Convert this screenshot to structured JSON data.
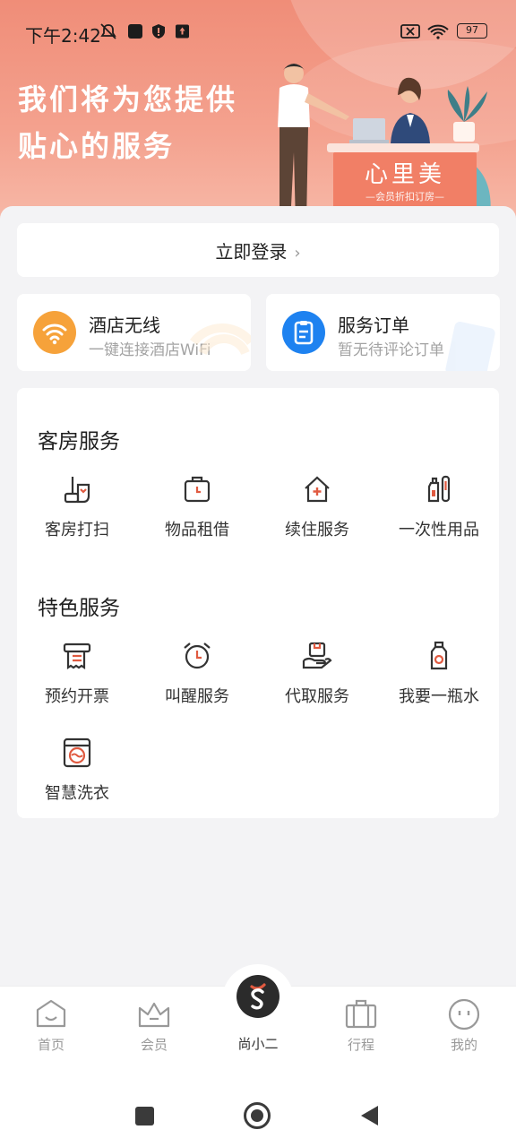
{
  "status_bar": {
    "time": "下午2:42",
    "battery": "97"
  },
  "hero": {
    "slogan_line1": "我们将为您提供",
    "slogan_line2": "贴心的服务",
    "brand_name": "心里美",
    "brand_sub": "—会员折扣订房—"
  },
  "login": {
    "label": "立即登录",
    "chevron": "›"
  },
  "quick_cards": [
    {
      "title": "酒店无线",
      "subtitle": "一键连接酒店WiFi",
      "icon": "wifi-icon",
      "color": "#f6a23a"
    },
    {
      "title": "服务订单",
      "subtitle": "暂无待评论订单",
      "icon": "clipboard-icon",
      "color": "#1e82f0"
    }
  ],
  "room_services": {
    "title": "客房服务",
    "items": [
      {
        "label": "客房打扫",
        "icon": "mop-icon"
      },
      {
        "label": "物品租借",
        "icon": "clock-box-icon"
      },
      {
        "label": "续住服务",
        "icon": "house-plus-icon"
      },
      {
        "label": "一次性用品",
        "icon": "toiletries-icon"
      }
    ]
  },
  "featured_services": {
    "title": "特色服务",
    "items": [
      {
        "label": "预约开票",
        "icon": "receipt-icon"
      },
      {
        "label": "叫醒服务",
        "icon": "alarm-clock-icon"
      },
      {
        "label": "代取服务",
        "icon": "hand-package-icon"
      },
      {
        "label": "我要一瓶水",
        "icon": "water-bottle-icon"
      },
      {
        "label": "智慧洗衣",
        "icon": "washing-machine-icon"
      }
    ]
  },
  "tabbar": {
    "tabs": [
      {
        "label": "首页",
        "icon": "home-icon"
      },
      {
        "label": "会员",
        "icon": "crown-icon"
      },
      {
        "label": "尚小二",
        "icon": "s-logo-icon"
      },
      {
        "label": "行程",
        "icon": "luggage-icon"
      },
      {
        "label": "我的",
        "icon": "face-icon"
      }
    ]
  },
  "colors": {
    "accent": "#e05a40",
    "hero": "#f08d78",
    "icon_stroke": "#333333"
  }
}
